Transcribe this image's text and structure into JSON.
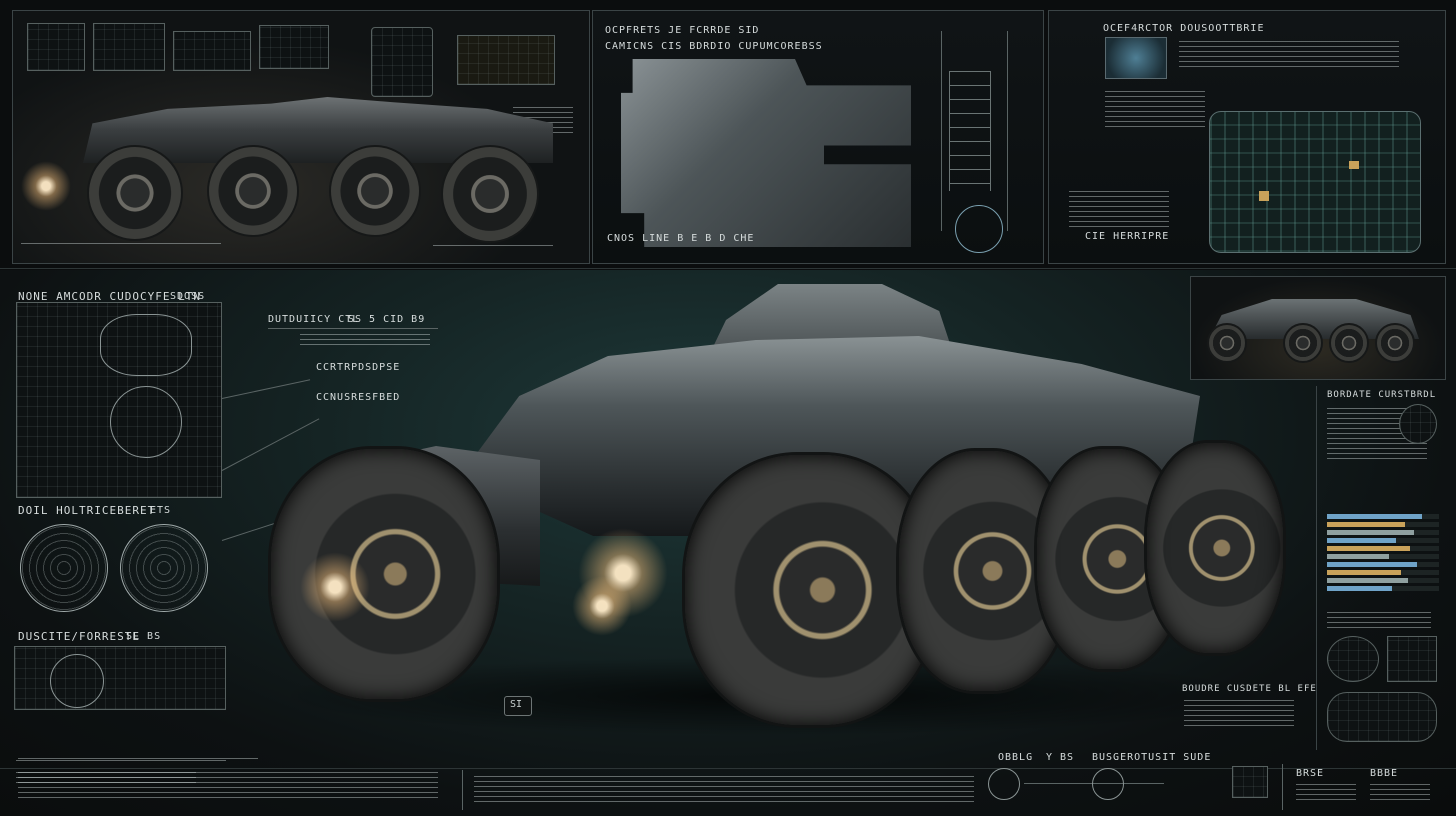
{
  "colors": {
    "background": "#0b0d0e",
    "panel_border": "#3b4446",
    "teal_haze": "#1f3b3a",
    "accent_gold": "#c9a25a",
    "accent_blue": "#6fa3c8",
    "headlight": "#ffe7c2"
  },
  "top_strip": {
    "panel_left": {
      "caption": ""
    },
    "panel_middle": {
      "header_line1": "OCPFRETS  JE FCRRDE  SID",
      "header_line2": "CAMICNS  CIS  BDRDIO CUPUMCOREBSS",
      "footer": "CNOS    LINE  B  E  B  D  CHE"
    },
    "panel_right": {
      "header": "OCEF4RCTOR DOUSOOTTBRIE",
      "footer": "CIE HERRIPRE"
    }
  },
  "left_column": {
    "title": "NONE AMCODR CUDOCYFE LTN",
    "title_tag": "SDOSS",
    "section2_title": "DOIL HOLTRICEBERET",
    "section2_tag": "ETS",
    "section3_title": "DUSCITE/FORRESTE",
    "section3_tag": "SL   BS"
  },
  "center_callouts": {
    "callout1": "DUTDUIICY  CTL",
    "callout1_value": "SS  5  CID  B9",
    "callout2": "CCRTRPDSDPSE",
    "callout3": "CCNUSRESFBED"
  },
  "right_column": {
    "header": "BORDATE CURSTBRDL",
    "lower_callout": "BOUDRE CUSDETE  BL  EFE",
    "bar_levels": [
      0.85,
      0.7,
      0.78,
      0.62,
      0.74,
      0.55,
      0.8,
      0.66,
      0.72,
      0.58
    ]
  },
  "bottom_strip": {
    "scale_label": "OBBLG",
    "scale_mid": "Y  BS",
    "scale_title": "BUSGEROTUSIT  SUDE",
    "corner_left": "BRSE",
    "corner_right": "BBBE"
  },
  "vehicle": {
    "subject": "armored-six-wheel-rover",
    "floor_badge": "SI"
  }
}
